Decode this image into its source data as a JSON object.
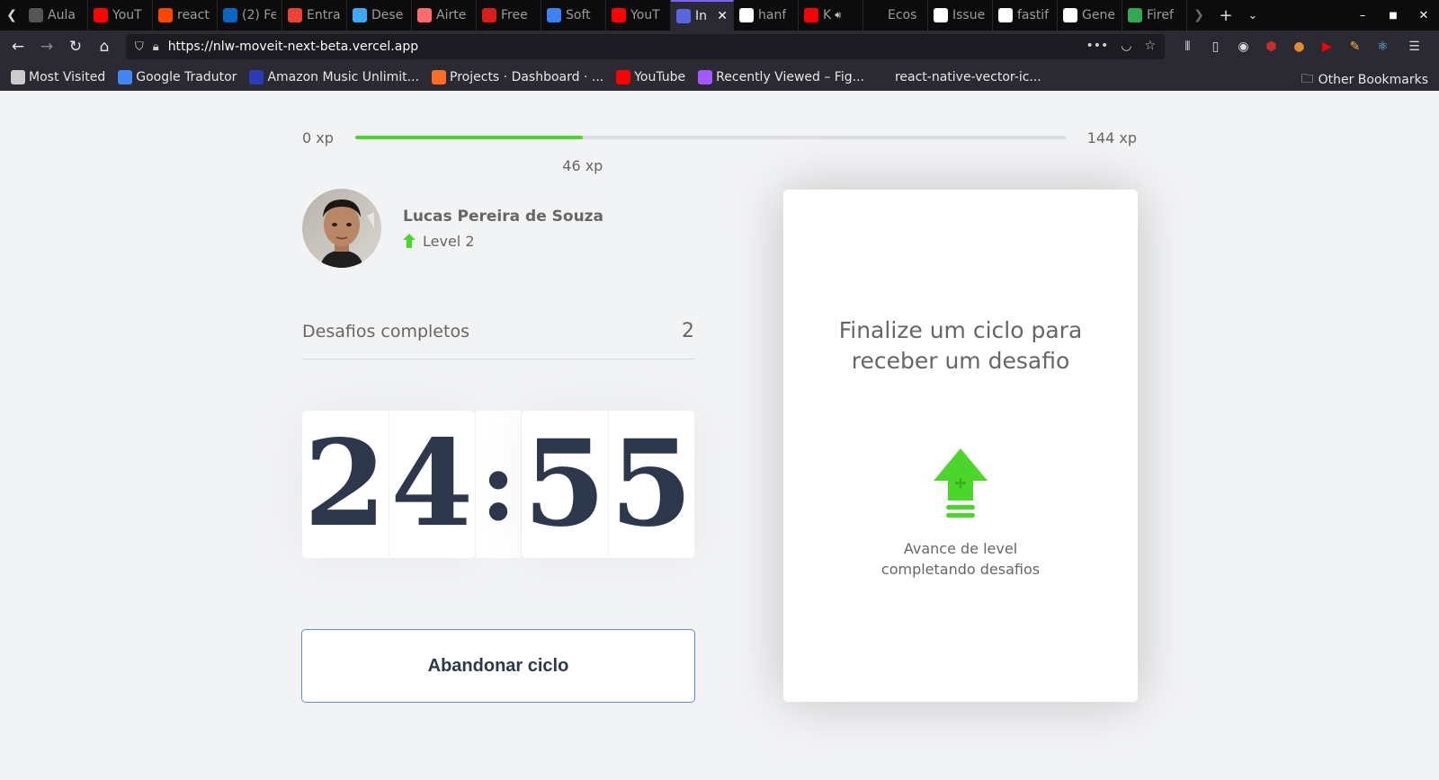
{
  "browser": {
    "tabs": [
      {
        "label": "Aula",
        "icon": "generic-page-icon",
        "color": "#555555"
      },
      {
        "label": "YouT",
        "icon": "youtube-icon",
        "color": "#ff0000"
      },
      {
        "label": "react",
        "icon": "reddit-icon",
        "color": "#ff4500"
      },
      {
        "label": "(2) Fe",
        "icon": "linkedin-icon",
        "color": "#0a66c2"
      },
      {
        "label": "Entra",
        "icon": "gmail-icon",
        "color": "#ea4335"
      },
      {
        "label": "Dese",
        "icon": "sparkle-icon",
        "color": "#3fa9f5"
      },
      {
        "label": "Airte",
        "icon": "airtable-icon",
        "color": "#ff6b6b"
      },
      {
        "label": "Free",
        "icon": "freesms-icon",
        "color": "#d91e18"
      },
      {
        "label": "Soft",
        "icon": "cube-icon",
        "color": "#3b82f6"
      },
      {
        "label": "YouT",
        "icon": "youtube-icon",
        "color": "#ff0000"
      },
      {
        "label": "In",
        "icon": "moveit-icon",
        "color": "#5965e0",
        "active": true
      },
      {
        "label": "hanf",
        "icon": "github-icon",
        "color": "#ffffff"
      },
      {
        "label": "K",
        "icon": "youtube-icon",
        "color": "#ff0000",
        "audio": true
      },
      {
        "label": "Ecos",
        "icon": "blank-icon",
        "color": "#0c0c0d"
      },
      {
        "label": "Issue",
        "icon": "github-icon",
        "color": "#ffffff"
      },
      {
        "label": "fastif",
        "icon": "github-icon",
        "color": "#ffffff"
      },
      {
        "label": "Gene",
        "icon": "gem-icon",
        "color": "#ffffff"
      },
      {
        "label": "Firef",
        "icon": "play-store-icon",
        "color": "#34a853"
      }
    ],
    "url": "https://nlw-moveit-next-beta.vercel.app",
    "bookmarks": [
      {
        "label": "Most Visited",
        "icon": "gear-icon",
        "color": "#cccccc"
      },
      {
        "label": "Google Tradutor",
        "icon": "translate-icon",
        "color": "#4285f4"
      },
      {
        "label": "Amazon Music Unlimit...",
        "icon": "amazon-music-icon",
        "color": "#2b3bb8"
      },
      {
        "label": "Projects · Dashboard · ...",
        "icon": "gitlab-icon",
        "color": "#fc6d26"
      },
      {
        "label": "YouTube",
        "icon": "youtube-icon",
        "color": "#ff0000"
      },
      {
        "label": "Recently Viewed – Fig...",
        "icon": "figma-icon",
        "color": "#a259ff"
      },
      {
        "label": "react-native-vector-ic...",
        "icon": "globe-icon",
        "color": "#2b2a33"
      }
    ],
    "other_bookmarks": "Other Bookmarks"
  },
  "experience": {
    "min_label": "0 xp",
    "max_label": "144 xp",
    "current_label": "46 xp",
    "progress": 0.32,
    "color": "#4cd62b"
  },
  "profile": {
    "name": "Lucas Pereira de Souza",
    "level_label": "Level 2"
  },
  "challenges": {
    "label": "Desafios completos",
    "count": "2"
  },
  "countdown": {
    "minute_left": "2",
    "minute_right": "4",
    "separator": ":",
    "second_left": "5",
    "second_right": "5"
  },
  "abandon_button": "Abandonar ciclo",
  "challenge_box": {
    "title": "Finalize um ciclo para receber um desafio",
    "subtitle": "Avance de level completando desafios"
  }
}
